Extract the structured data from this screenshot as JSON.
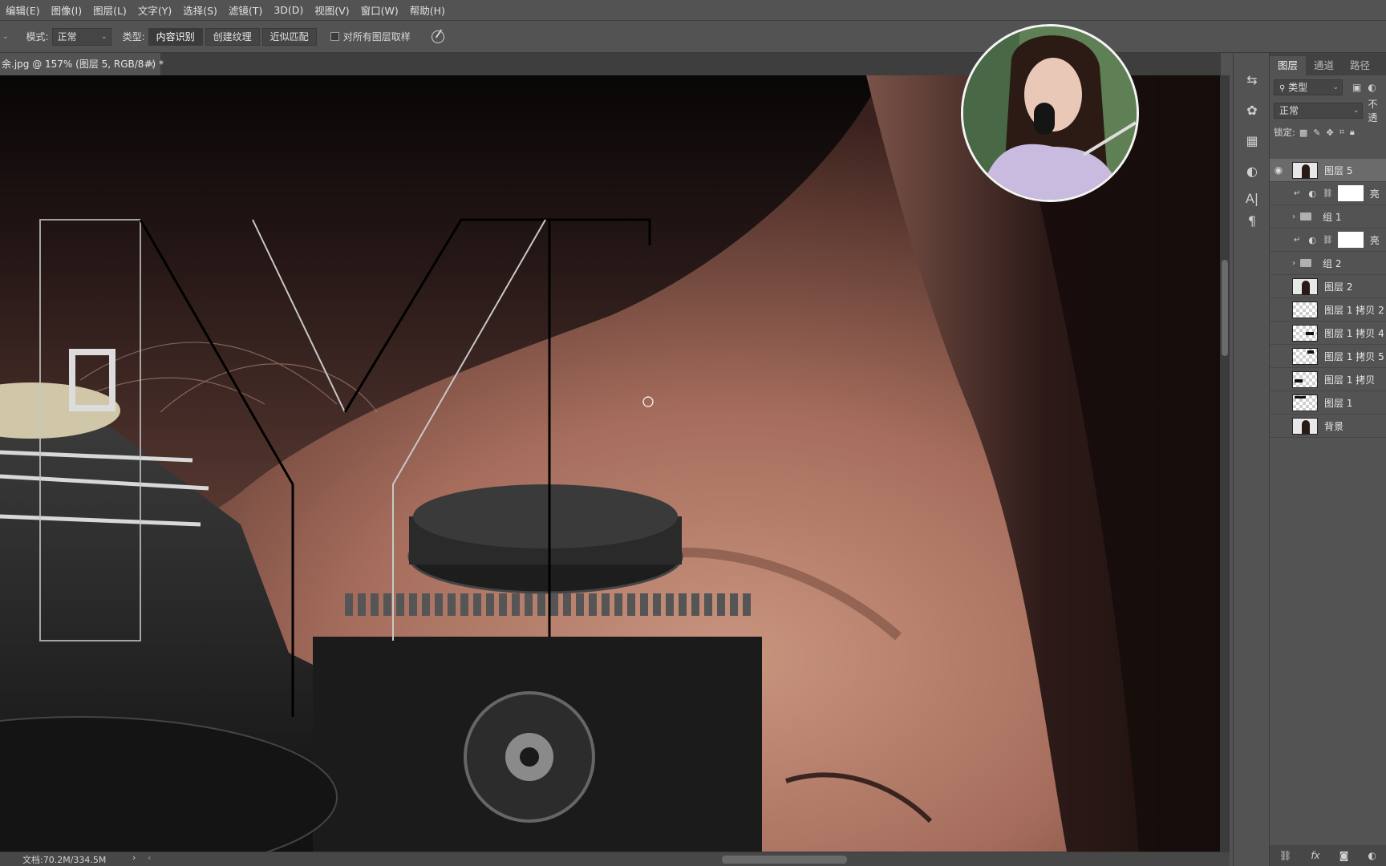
{
  "menu": [
    "编辑(E)",
    "图像(I)",
    "图层(L)",
    "文字(Y)",
    "选择(S)",
    "滤镜(T)",
    "3D(D)",
    "视图(V)",
    "窗口(W)",
    "帮助(H)"
  ],
  "options": {
    "mode_label": "模式:",
    "mode_value": "正常",
    "type_label": "类型:",
    "type_buttons": [
      "内容识别",
      "创建纹理",
      "近似匹配"
    ],
    "active_type": "内容识别",
    "sample_all_label": "对所有图层取样"
  },
  "document_tab": {
    "title": "余.jpg @ 157% (图层 5, RGB/8#) *",
    "close": "×"
  },
  "status": {
    "doc_size": "文档:70.2M/334.5M"
  },
  "panel": {
    "tabs": [
      "图层",
      "通道",
      "路径"
    ],
    "filter_label": "类型",
    "blend_mode": "正常",
    "opacity_label": "不透",
    "lock_label": "锁定:"
  },
  "layers": [
    {
      "name": "图层 5",
      "kind": "photo",
      "visible": true,
      "selected": true
    },
    {
      "name": "亮",
      "kind": "adjust",
      "visible": false
    },
    {
      "name": "组 1",
      "kind": "group",
      "visible": false
    },
    {
      "name": "亮",
      "kind": "adjust",
      "visible": false
    },
    {
      "name": "组 2",
      "kind": "group",
      "visible": false
    },
    {
      "name": "图层 2",
      "kind": "photo",
      "visible": false
    },
    {
      "name": "图层 1 拷贝 2",
      "kind": "checker",
      "visible": false
    },
    {
      "name": "图层 1 拷贝 4",
      "kind": "checker",
      "visible": false
    },
    {
      "name": "图层 1 拷贝 5",
      "kind": "checker",
      "visible": false
    },
    {
      "name": "图层 1 拷贝",
      "kind": "checker",
      "visible": false
    },
    {
      "name": "图层 1",
      "kind": "checker",
      "visible": false
    },
    {
      "name": "背景",
      "kind": "photo",
      "visible": false
    }
  ],
  "colors": {
    "ui_bg": "#535353",
    "selected_layer": "#6b6b6b",
    "hair": "#4a3029",
    "skin": "#b98573"
  }
}
